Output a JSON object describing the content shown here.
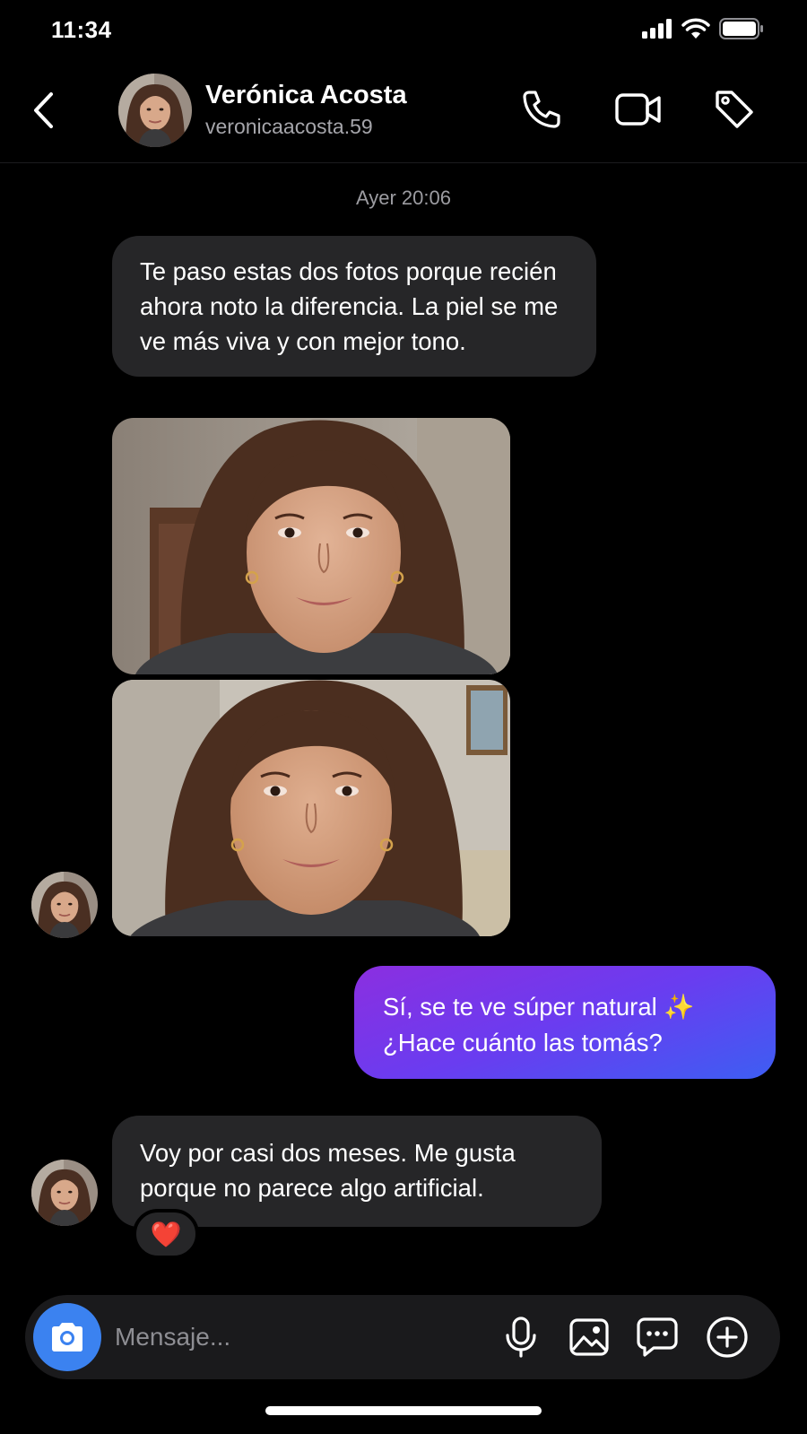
{
  "status_bar": {
    "time": "11:34"
  },
  "header": {
    "back_icon": "chevron-left-icon",
    "name": "Verónica Acosta",
    "handle": "veronicaacosta.59",
    "actions": [
      "phone-icon",
      "video-camera-icon",
      "tag-icon"
    ]
  },
  "thread": {
    "timestamp": "Ayer 20:06",
    "messages": [
      {
        "from": "them",
        "text": "Te paso estas dos fotos porque recién ahora noto la diferencia. La piel se me ve más viva y con mejor tono."
      },
      {
        "from": "them",
        "type": "photo",
        "subject": "selfie-1"
      },
      {
        "from": "them",
        "type": "photo",
        "subject": "selfie-2"
      },
      {
        "from": "me",
        "line1": "Sí, se te ve súper natural ✨",
        "line2": "¿Hace cuánto las tomás?"
      },
      {
        "from": "them",
        "text": "Voy por casi dos meses. Me gusta porque no parece algo artificial.",
        "reaction": "❤️"
      }
    ]
  },
  "composer": {
    "placeholder": "Mensaje...",
    "icons": [
      "camera-icon",
      "microphone-icon",
      "image-icon",
      "chat-bubble-icon",
      "plus-circle-icon"
    ]
  },
  "colors": {
    "background": "#000000",
    "incoming_bubble": "#262628",
    "outgoing_gradient_start": "#8b2fe0",
    "outgoing_gradient_end": "#3d5ef3",
    "camera_button": "#3b82f0"
  }
}
